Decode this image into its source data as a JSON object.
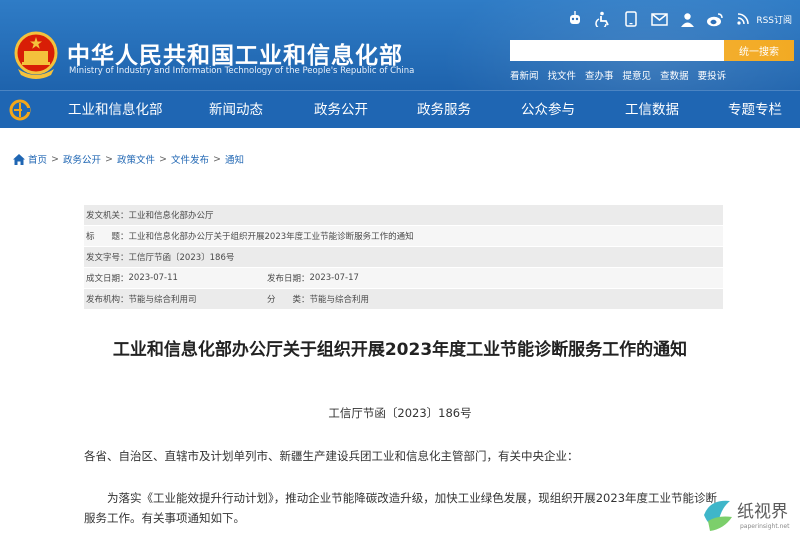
{
  "header": {
    "title_cn": "中华人民共和国工业和信息化部",
    "title_en": "Ministry of Industry and Information Technology of the People's Republic of China",
    "icons": [
      "wechat-robot-icon",
      "accessibility-icon",
      "mobile-icon",
      "mail-icon",
      "user-icon",
      "weibo-icon",
      "rss-icon"
    ],
    "rss_label": "RSS订阅",
    "search": {
      "value": "",
      "placeholder": "",
      "button_label": "统一搜索"
    },
    "quick_links": [
      "看新闻",
      "找文件",
      "查办事",
      "提意见",
      "查数据",
      "要投诉"
    ]
  },
  "nav": {
    "items": [
      "工业和信息化部",
      "新闻动态",
      "政务公开",
      "政务服务",
      "公众参与",
      "工信数据",
      "专题专栏"
    ]
  },
  "breadcrumb": [
    "首页",
    "政务公开",
    "政策文件",
    "文件发布",
    "通知"
  ],
  "meta": {
    "issuer_label": "发文机关：",
    "issuer": "工业和信息化部办公厅",
    "title_label": "标　　题：",
    "title": "工业和信息化部办公厅关于组织开展2023年度工业节能诊断服务工作的通知",
    "docno_label": "发文字号：",
    "docno": "工信厅节函〔2023〕186号",
    "created_label": "成文日期：",
    "created": "2023-07-11",
    "published_label": "发布日期：",
    "published": "2023-07-17",
    "org_label": "发布机构：",
    "org": "节能与综合利用司",
    "category_label": "分　　类：",
    "category": "节能与综合利用"
  },
  "article": {
    "title": "工业和信息化部办公厅关于组织开展2023年度工业节能诊断服务工作的通知",
    "doc_number": "工信厅节函〔2023〕186号",
    "recipients": "各省、自治区、直辖市及计划单列市、新疆生产建设兵团工业和信息化主管部门，有关中央企业：",
    "paragraph": "为落实《工业能效提升行动计划》，推动企业节能降碳改造升级，加快工业绿色发展，现组织开展2023年度工业节能诊断服务工作。有关事项通知如下。"
  },
  "watermark": {
    "text": "纸视界",
    "sub": "paperinsight.net"
  },
  "colors": {
    "header_blue": "#2f7cc6",
    "nav_blue": "#1f66b3",
    "search_orange": "#f2a71b",
    "link_blue": "#1f66b3"
  }
}
